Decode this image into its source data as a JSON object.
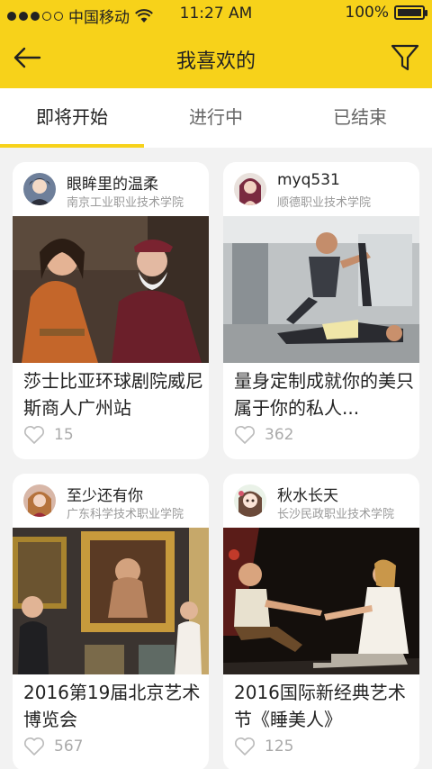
{
  "status": {
    "carrier": "中国移动",
    "time": "11:27 AM",
    "battery": "100%"
  },
  "nav": {
    "title": "我喜欢的",
    "back_icon": "back-arrow-icon",
    "filter_icon": "filter-icon"
  },
  "tabs": [
    {
      "label": "即将开始",
      "active": true
    },
    {
      "label": "进行中",
      "active": false
    },
    {
      "label": "已结束",
      "active": false
    }
  ],
  "cards": [
    {
      "user": "眼眸里的温柔",
      "school": "南京工业职业技术学院",
      "title": "莎士比亚环球剧院威尼斯商人广州站",
      "likes": "15"
    },
    {
      "user": "myq531",
      "school": "顺德职业技术学院",
      "title": "量身定制成就你的美只属于你的私人...",
      "likes": "362"
    },
    {
      "user": "至少还有你",
      "school": "广东科学技术职业学院",
      "title": "2016第19届北京艺术博览会",
      "likes": "567"
    },
    {
      "user": "秋水长天",
      "school": "长沙民政职业技术学院",
      "title": "2016国际新经典艺术节《睡美人》",
      "likes": "125"
    }
  ],
  "colors": {
    "accent": "#f7d21a",
    "background": "#f2f2f2"
  }
}
